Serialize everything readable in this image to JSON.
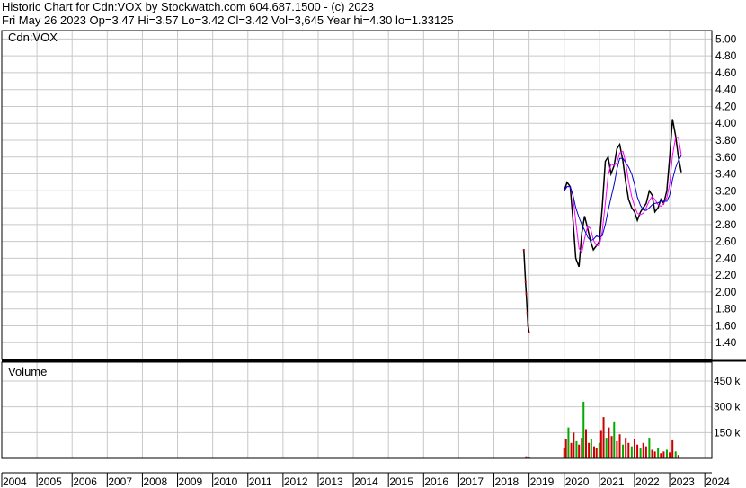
{
  "header": {
    "line1": "Historic Chart for Cdn:VOX by Stockwatch.com 604.687.1500 - (c) 2023",
    "line2": "Fri May 26 2023  Op=3.47  Hi=3.57  Lo=3.42  Cl=3.42  Vol=3,645  Year hi=4.30  lo=1.33125"
  },
  "chart_data": [
    {
      "type": "line",
      "title": "Cdn:VOX",
      "series": [
        {
          "values": [
            [
              2018.85,
              2.5
            ],
            [
              2018.9,
              2.12
            ],
            [
              2018.92,
              1.98
            ],
            [
              2018.95,
              1.75
            ],
            [
              2018.97,
              1.6
            ],
            [
              2019.0,
              1.52
            ],
            [
              2020.0,
              3.2
            ],
            [
              2020.08,
              3.3
            ],
            [
              2020.17,
              3.25
            ],
            [
              2020.25,
              2.85
            ],
            [
              2020.33,
              2.4
            ],
            [
              2020.42,
              2.3
            ],
            [
              2020.5,
              2.7
            ],
            [
              2020.58,
              2.9
            ],
            [
              2020.67,
              2.75
            ],
            [
              2020.75,
              2.6
            ],
            [
              2020.83,
              2.5
            ],
            [
              2020.92,
              2.55
            ],
            [
              2021.0,
              2.6
            ],
            [
              2021.08,
              3.0
            ],
            [
              2021.17,
              3.55
            ],
            [
              2021.25,
              3.6
            ],
            [
              2021.33,
              3.4
            ],
            [
              2021.42,
              3.5
            ],
            [
              2021.5,
              3.7
            ],
            [
              2021.58,
              3.75
            ],
            [
              2021.67,
              3.55
            ],
            [
              2021.75,
              3.3
            ],
            [
              2021.83,
              3.1
            ],
            [
              2021.92,
              3.0
            ],
            [
              2022.0,
              2.95
            ],
            [
              2022.08,
              2.85
            ],
            [
              2022.17,
              2.95
            ],
            [
              2022.25,
              3.0
            ],
            [
              2022.33,
              3.05
            ],
            [
              2022.42,
              3.2
            ],
            [
              2022.5,
              3.15
            ],
            [
              2022.58,
              2.95
            ],
            [
              2022.67,
              3.0
            ],
            [
              2022.75,
              3.1
            ],
            [
              2022.83,
              3.05
            ],
            [
              2022.92,
              3.2
            ],
            [
              2023.0,
              3.6
            ],
            [
              2023.08,
              4.05
            ],
            [
              2023.17,
              3.85
            ],
            [
              2023.25,
              3.6
            ],
            [
              2023.33,
              3.42
            ]
          ]
        }
      ],
      "x_ticks": [
        "2004",
        "2005",
        "2006",
        "2007",
        "2008",
        "2009",
        "2010",
        "2011",
        "2012",
        "2013",
        "2014",
        "2015",
        "2016",
        "2017",
        "2018",
        "2019",
        "2020",
        "2021",
        "2022",
        "2023",
        "2024"
      ],
      "y_ticks": [
        "5.00",
        "4.80",
        "4.60",
        "4.40",
        "4.20",
        "4.00",
        "3.80",
        "3.60",
        "3.40",
        "3.20",
        "3.00",
        "2.80",
        "2.60",
        "2.40",
        "2.20",
        "2.00",
        "1.80",
        "1.60",
        "1.40"
      ],
      "ylim": [
        1.2,
        5.1
      ],
      "xlim": [
        2004.0,
        2024.2
      ],
      "grid": true,
      "colors": {
        "price": "#000000",
        "ma_short": "#ff00ff",
        "ma_long": "#0000cc",
        "split_marker": "#cc0000"
      }
    },
    {
      "type": "bar",
      "title": "Volume",
      "y_ticks": [
        "450 k",
        "300 k",
        "150 k"
      ],
      "ylim": [
        0,
        560000
      ],
      "series": [
        {
          "values": [
            [
              2018.92,
              12000
            ],
            [
              2019.0,
              8000
            ],
            [
              2020.0,
              60000
            ],
            [
              2020.05,
              110000
            ],
            [
              2020.12,
              180000
            ],
            [
              2020.2,
              90000
            ],
            [
              2020.27,
              150000
            ],
            [
              2020.35,
              100000
            ],
            [
              2020.42,
              80000
            ],
            [
              2020.5,
              120000
            ],
            [
              2020.55,
              330000
            ],
            [
              2020.62,
              170000
            ],
            [
              2020.7,
              90000
            ],
            [
              2020.77,
              110000
            ],
            [
              2020.85,
              70000
            ],
            [
              2020.92,
              60000
            ],
            [
              2021.0,
              90000
            ],
            [
              2021.05,
              160000
            ],
            [
              2021.12,
              240000
            ],
            [
              2021.2,
              120000
            ],
            [
              2021.27,
              180000
            ],
            [
              2021.35,
              130000
            ],
            [
              2021.42,
              210000
            ],
            [
              2021.5,
              100000
            ],
            [
              2021.58,
              140000
            ],
            [
              2021.67,
              80000
            ],
            [
              2021.75,
              120000
            ],
            [
              2021.83,
              90000
            ],
            [
              2021.92,
              70000
            ],
            [
              2022.0,
              110000
            ],
            [
              2022.08,
              80000
            ],
            [
              2022.17,
              60000
            ],
            [
              2022.25,
              90000
            ],
            [
              2022.33,
              70000
            ],
            [
              2022.42,
              120000
            ],
            [
              2022.5,
              50000
            ],
            [
              2022.58,
              40000
            ],
            [
              2022.67,
              60000
            ],
            [
              2022.75,
              30000
            ],
            [
              2022.83,
              40000
            ],
            [
              2022.92,
              50000
            ],
            [
              2023.0,
              35000
            ],
            [
              2023.08,
              105000
            ],
            [
              2023.17,
              40000
            ],
            [
              2023.25,
              20000
            ]
          ]
        }
      ],
      "colors": {
        "up": "#00aa00",
        "down": "#cc0000"
      }
    }
  ]
}
